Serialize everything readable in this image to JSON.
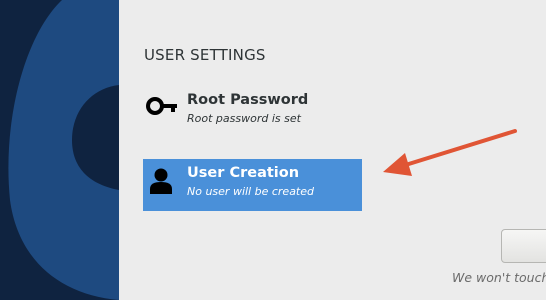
{
  "section": {
    "title": "USER SETTINGS"
  },
  "spokes": [
    {
      "title": "Root Password",
      "status": "Root password is set",
      "icon": "key-icon"
    },
    {
      "title": "User Creation",
      "status": "No user will be created",
      "icon": "user-icon",
      "selected": true
    }
  ],
  "footer": {
    "note": "We won't touch"
  },
  "colors": {
    "sidebar": "#0f2340",
    "sidebar_shape": "#1e4a80",
    "selection": "#4a90d9",
    "arrow": "#e05535",
    "background": "#ececec"
  }
}
